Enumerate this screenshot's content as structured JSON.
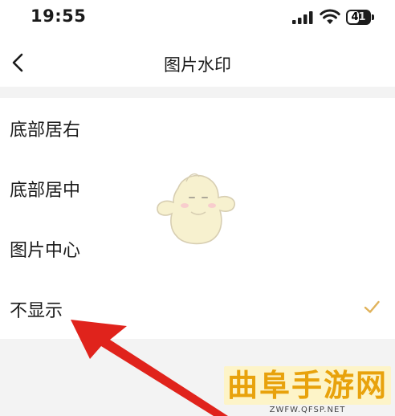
{
  "status_bar": {
    "time": "19:55",
    "battery_level": "41"
  },
  "nav": {
    "back_icon": "chevron-left-icon",
    "title": "图片水印"
  },
  "options": [
    {
      "label": "底部居右",
      "selected": false
    },
    {
      "label": "底部居中",
      "selected": false
    },
    {
      "label": "图片中心",
      "selected": false
    },
    {
      "label": "不显示",
      "selected": true
    }
  ],
  "colors": {
    "check": "#e0b25a",
    "arrow": "#e0231c",
    "logo_text": "#e8a20c",
    "band": "#f3f3f3"
  },
  "overlay": {
    "site_logo_text": "曲阜手游网",
    "site_logo_url": "ZWFW.QFSP.NET"
  }
}
